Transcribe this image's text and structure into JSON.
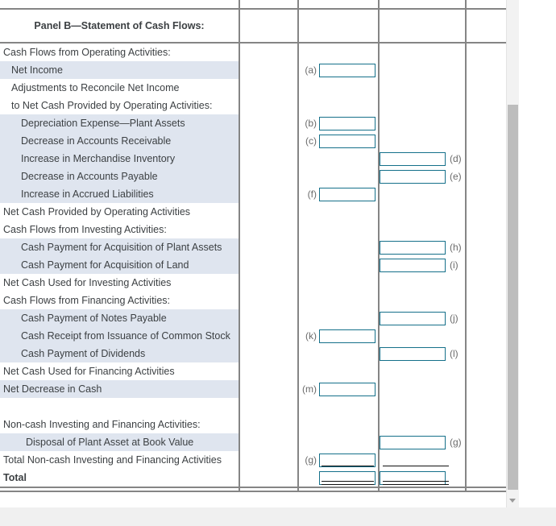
{
  "panel": {
    "title": "Panel B—Statement of Cash Flows:"
  },
  "colors": {
    "shade": "#dfe5ef",
    "input_border": "#15708a",
    "grid": "#858585",
    "text": "#3c4043",
    "tag": "#6b6b6b",
    "scroll_thumb": "#bdbdbd",
    "scroll_track": "#f2f2f2"
  },
  "rows": [
    {
      "label": "Cash Flows from Operating Activities:",
      "indent": 0,
      "shaded": false,
      "bold": false,
      "c3": {
        "tag": "",
        "input": false,
        "value": ""
      },
      "c4": {
        "tag": "",
        "input": false,
        "value": ""
      }
    },
    {
      "label": "Net Income",
      "indent": 1,
      "shaded": true,
      "bold": false,
      "c3": {
        "tag": "(a)",
        "input": true,
        "value": ""
      },
      "c4": {
        "tag": "",
        "input": false,
        "value": ""
      }
    },
    {
      "label": "Adjustments to Reconcile Net Income",
      "indent": 1,
      "shaded": false,
      "bold": false,
      "c3": {
        "tag": "",
        "input": false,
        "value": ""
      },
      "c4": {
        "tag": "",
        "input": false,
        "value": ""
      }
    },
    {
      "label": "to Net Cash Provided by Operating Activities:",
      "indent": 1,
      "shaded": false,
      "bold": false,
      "c3": {
        "tag": "",
        "input": false,
        "value": ""
      },
      "c4": {
        "tag": "",
        "input": false,
        "value": ""
      }
    },
    {
      "label": "Depreciation Expense—Plant Assets",
      "indent": 2,
      "shaded": true,
      "bold": false,
      "c3": {
        "tag": "(b)",
        "input": true,
        "value": ""
      },
      "c4": {
        "tag": "",
        "input": false,
        "value": ""
      }
    },
    {
      "label": "Decrease in Accounts Receivable",
      "indent": 2,
      "shaded": true,
      "bold": false,
      "c3": {
        "tag": "(c)",
        "input": true,
        "value": ""
      },
      "c4": {
        "tag": "",
        "input": false,
        "value": ""
      }
    },
    {
      "label": "Increase in Merchandise Inventory",
      "indent": 2,
      "shaded": true,
      "bold": false,
      "c3": {
        "tag": "",
        "input": false,
        "value": ""
      },
      "c4": {
        "tag": "(d)",
        "input": true,
        "value": ""
      }
    },
    {
      "label": "Decrease in Accounts Payable",
      "indent": 2,
      "shaded": true,
      "bold": false,
      "c3": {
        "tag": "",
        "input": false,
        "value": ""
      },
      "c4": {
        "tag": "(e)",
        "input": true,
        "value": ""
      }
    },
    {
      "label": "Increase in Accrued Liabilities",
      "indent": 2,
      "shaded": true,
      "bold": false,
      "c3": {
        "tag": "(f)",
        "input": true,
        "value": ""
      },
      "c4": {
        "tag": "",
        "input": false,
        "value": ""
      }
    },
    {
      "label": "Net Cash Provided by Operating Activities",
      "indent": 0,
      "shaded": false,
      "bold": false,
      "c3": {
        "tag": "",
        "input": false,
        "value": ""
      },
      "c4": {
        "tag": "",
        "input": false,
        "value": ""
      }
    },
    {
      "label": "Cash Flows from Investing Activities:",
      "indent": 0,
      "shaded": false,
      "bold": false,
      "c3": {
        "tag": "",
        "input": false,
        "value": ""
      },
      "c4": {
        "tag": "",
        "input": false,
        "value": ""
      }
    },
    {
      "label": "Cash Payment for Acquisition of Plant Assets",
      "indent": 2,
      "shaded": true,
      "bold": false,
      "c3": {
        "tag": "",
        "input": false,
        "value": ""
      },
      "c4": {
        "tag": "(h)",
        "input": true,
        "value": ""
      }
    },
    {
      "label": "Cash Payment for Acquisition of Land",
      "indent": 2,
      "shaded": true,
      "bold": false,
      "c3": {
        "tag": "",
        "input": false,
        "value": ""
      },
      "c4": {
        "tag": "(i)",
        "input": true,
        "value": ""
      }
    },
    {
      "label": "Net Cash Used for Investing Activities",
      "indent": 0,
      "shaded": false,
      "bold": false,
      "c3": {
        "tag": "",
        "input": false,
        "value": ""
      },
      "c4": {
        "tag": "",
        "input": false,
        "value": ""
      }
    },
    {
      "label": "Cash Flows from Financing Activities:",
      "indent": 0,
      "shaded": false,
      "bold": false,
      "c3": {
        "tag": "",
        "input": false,
        "value": ""
      },
      "c4": {
        "tag": "",
        "input": false,
        "value": ""
      }
    },
    {
      "label": "Cash Payment of Notes Payable",
      "indent": 2,
      "shaded": true,
      "bold": false,
      "c3": {
        "tag": "",
        "input": false,
        "value": ""
      },
      "c4": {
        "tag": "(j)",
        "input": true,
        "value": ""
      }
    },
    {
      "label": "Cash Receipt from Issuance of Common Stock",
      "indent": 2,
      "shaded": true,
      "bold": false,
      "c3": {
        "tag": "(k)",
        "input": true,
        "value": ""
      },
      "c4": {
        "tag": "",
        "input": false,
        "value": ""
      }
    },
    {
      "label": "Cash Payment of Dividends",
      "indent": 2,
      "shaded": true,
      "bold": false,
      "c3": {
        "tag": "",
        "input": false,
        "value": ""
      },
      "c4": {
        "tag": "(l)",
        "input": true,
        "value": ""
      }
    },
    {
      "label": "Net Cash Used for Financing Activities",
      "indent": 0,
      "shaded": false,
      "bold": false,
      "c3": {
        "tag": "",
        "input": false,
        "value": ""
      },
      "c4": {
        "tag": "",
        "input": false,
        "value": ""
      }
    },
    {
      "label": "Net Decrease in Cash",
      "indent": 0,
      "shaded": true,
      "bold": false,
      "c3": {
        "tag": "(m)",
        "input": true,
        "value": ""
      },
      "c4": {
        "tag": "",
        "input": false,
        "value": ""
      }
    },
    {
      "label": "",
      "indent": 0,
      "shaded": false,
      "bold": false,
      "c3": {
        "tag": "",
        "input": false,
        "value": ""
      },
      "c4": {
        "tag": "",
        "input": false,
        "value": ""
      }
    },
    {
      "label": "Non-cash Investing and Financing Activities:",
      "indent": 0,
      "shaded": false,
      "bold": false,
      "c3": {
        "tag": "",
        "input": false,
        "value": ""
      },
      "c4": {
        "tag": "",
        "input": false,
        "value": ""
      }
    },
    {
      "label": "Disposal of Plant Asset at Book Value",
      "indent": 3,
      "shaded": true,
      "bold": false,
      "c3": {
        "tag": "",
        "input": false,
        "value": ""
      },
      "c4": {
        "tag": "(g)",
        "input": true,
        "value": ""
      }
    },
    {
      "label": "Total Non-cash Investing and Financing Activities",
      "indent": 0,
      "shaded": false,
      "bold": false,
      "c3": {
        "tag": "(g)",
        "input": true,
        "value": "",
        "rule": "single"
      },
      "c4": {
        "tag": "",
        "input": false,
        "value": "",
        "rule": "single"
      }
    },
    {
      "label": "Total",
      "indent": 0,
      "shaded": false,
      "bold": true,
      "c3": {
        "tag": "",
        "input": true,
        "value": "",
        "rule": "double"
      },
      "c4": {
        "tag": "",
        "input": true,
        "value": "",
        "rule": "double"
      }
    }
  ],
  "scrollbar": {
    "down_arrow": "chevron-down-icon",
    "thumb_position_pct": 21
  }
}
